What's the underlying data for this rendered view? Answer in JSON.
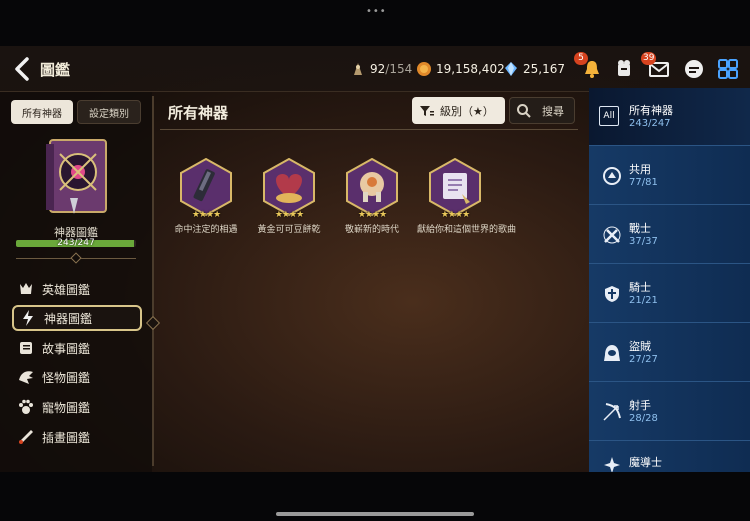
{
  "window": {
    "top_dots": "•••"
  },
  "header": {
    "title": "圖鑑",
    "stamina": {
      "current": "92",
      "max": "/154"
    },
    "gold": "19,158,402",
    "crystals": "25,167",
    "notification_badge": "5",
    "mail_badge": "39",
    "icons": [
      "back-chevron-icon",
      "stamina-icon",
      "gold-coin-icon",
      "crystal-icon",
      "bell-icon",
      "team-icon",
      "mail-icon",
      "chat-icon",
      "grid-menu-icon"
    ]
  },
  "left_panel": {
    "tabs": [
      "所有神器",
      "設定類別"
    ],
    "collection_title": "神器圖鑑",
    "progress_text": "243/247",
    "progress_fraction": 0.984,
    "nav": [
      {
        "label": "英雄圖鑑",
        "icon": "hero-icon"
      },
      {
        "label": "神器圖鑑",
        "icon": "artifact-icon"
      },
      {
        "label": "故事圖鑑",
        "icon": "story-icon"
      },
      {
        "label": "怪物圖鑑",
        "icon": "monster-icon"
      },
      {
        "label": "寵物圖鑑",
        "icon": "paw-icon"
      },
      {
        "label": "插畫圖鑑",
        "icon": "illustration-icon"
      }
    ]
  },
  "main": {
    "section_title": "所有神器",
    "sort_label": "級別（★）",
    "search_label": "搜尋",
    "artifacts": [
      {
        "name": "命中注定的相遇",
        "stars": "★★★★"
      },
      {
        "name": "黃金可可豆餅乾",
        "stars": "★★★★"
      },
      {
        "name": "敬嶄新的時代",
        "stars": "★★★★"
      },
      {
        "name": "獻給你和這個世界的歌曲",
        "stars": "★★★★"
      }
    ]
  },
  "categories": [
    {
      "label": "所有神器",
      "count": "243/247",
      "icon": "all-icon",
      "icon_text": "All"
    },
    {
      "label": "共用",
      "count": "77/81",
      "icon": "common-class-icon"
    },
    {
      "label": "戰士",
      "count": "37/37",
      "icon": "warrior-icon"
    },
    {
      "label": "騎士",
      "count": "21/21",
      "icon": "knight-icon"
    },
    {
      "label": "盜賊",
      "count": "27/27",
      "icon": "thief-icon"
    },
    {
      "label": "射手",
      "count": "28/28",
      "icon": "ranger-icon"
    },
    {
      "label": "魔導士",
      "count": "",
      "icon": "mage-icon"
    }
  ],
  "colors": {
    "accent_blue": "#163a66",
    "active_outline": "#d8c58a",
    "progress_green": "#6aa83a",
    "badge_red": "#d6431f"
  }
}
